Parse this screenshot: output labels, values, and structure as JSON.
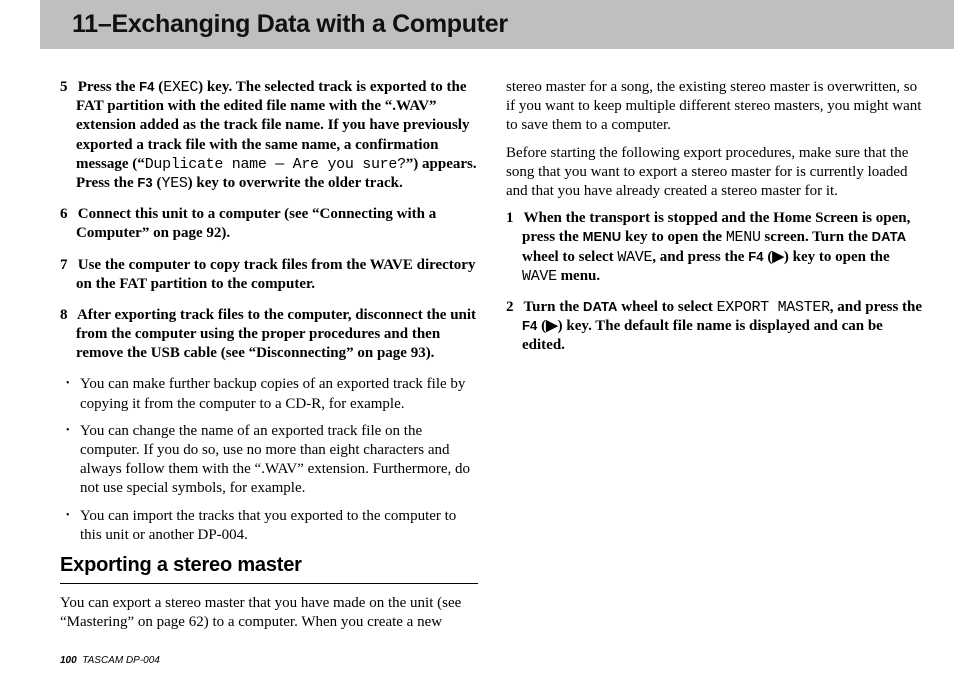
{
  "page": {
    "chapter_number": "11",
    "chapter_title": "Exchanging Data with a Computer",
    "footer_page": "100",
    "footer_model": "TASCAM  DP-004"
  },
  "steps_a": [
    {
      "num": "5",
      "pre": "Press the ",
      "key1": "F4",
      "paren_open": " (",
      "mono1": "EXEC",
      "paren_close": ")",
      "mid": " key. The selected track is exported to the FAT partition with the edited file name with the “.WAV” extension added as the track file name. If you have previously exported a track file with the same name, a confirmation message (“",
      "mono2": "Duplicate name — Are you sure?",
      "mid2": "”) appears. Press the ",
      "key2": "F3",
      "paren2_open": " (",
      "mono3": "YES",
      "paren2_close": ")",
      "post": " key to overwrite the older track."
    },
    {
      "num": "6",
      "text": "Connect this unit to a computer (see “Connecting with a Computer” on page 92)."
    },
    {
      "num": "7",
      "text": "Use the computer to copy track files from the WAVE directory on the FAT partition to the computer."
    },
    {
      "num": "8",
      "text": "After exporting track files to the computer, disconnect the unit from the computer using the proper procedures and then remove the USB cable (see “Disconnecting” on page 93)."
    }
  ],
  "notes_a": [
    "You can make further backup copies of an exported track file by copying it from the computer to a CD-R, for example.",
    "You can change the name of an exported track file on the computer. If you do so, use no more than eight characters and always follow them with the “.WAV” extension. Furthermore, do not use special symbols, for example.",
    "You can import the tracks that you exported to the computer to this unit or another DP-004."
  ],
  "section_b": {
    "heading": "Exporting a stereo master",
    "para1": "You can export a stereo master that you have made on the unit (see “Mastering” on page 62) to a computer. When you create a new stereo master for a song, the existing stereo master is overwritten, so if you want to keep multiple different stereo masters, you might want to save them to a computer.",
    "para2": "Before starting the following export procedures, make sure that the song that you want to export a stereo master for is currently loaded and that you have already created a stereo master for it."
  },
  "steps_b": [
    {
      "num": "1",
      "t1": "When the transport is stopped and the Home Screen is open, press the ",
      "k1": "MENU",
      "t2": " key to open the ",
      "m1": "MENU",
      "t3": " screen. Turn the ",
      "k2": "DATA",
      "t4": " wheel to select ",
      "m2": "WAVE",
      "t5": ", and press the ",
      "k3": "F4",
      "t6": " (▶) key to open the ",
      "m3": "WAVE",
      "t7": " menu."
    },
    {
      "num": "2",
      "t1": "Turn the ",
      "k1": "DATA",
      "t2": " wheel to select ",
      "m1": "EXPORT MASTER",
      "t3": ", and press the ",
      "k2": "F4",
      "t4": " (▶) key. The default file name is displayed and can be edited."
    }
  ]
}
